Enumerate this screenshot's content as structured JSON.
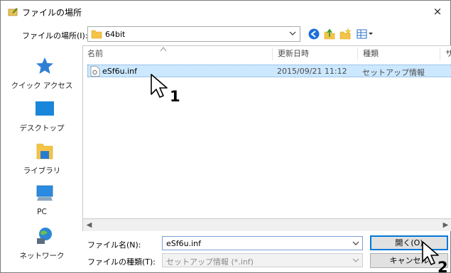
{
  "window": {
    "title": "ファイルの場所",
    "close_glyph": "×"
  },
  "location": {
    "label": "ファイルの場所(I):",
    "value": "64bit"
  },
  "toolbar": {
    "icons": [
      "back-icon",
      "up-folder-icon",
      "new-folder-icon",
      "view-menu-icon"
    ]
  },
  "places": [
    {
      "label": "クイック アクセス",
      "icon": "quick-access-star-icon"
    },
    {
      "label": "デスクトップ",
      "icon": "desktop-icon"
    },
    {
      "label": "ライブラリ",
      "icon": "library-icon"
    },
    {
      "label": "PC",
      "icon": "pc-icon"
    },
    {
      "label": "ネットワーク",
      "icon": "network-icon"
    }
  ],
  "columns": {
    "name": "名前",
    "modified": "更新日時",
    "type": "種類",
    "size": "サ"
  },
  "files": [
    {
      "name": "eSf6u.inf",
      "modified": "2015/09/21 11:12",
      "type": "セットアップ情報",
      "selected": true
    }
  ],
  "filename": {
    "label": "ファイル名(N):",
    "value": "eSf6u.inf"
  },
  "filetype": {
    "label": "ファイルの種類(T):",
    "value": "セットアップ情報 (*.inf)"
  },
  "buttons": {
    "open": "開く(O)",
    "cancel": "キャンセル"
  },
  "annotations": {
    "step1": "1",
    "step2": "2"
  },
  "colors": {
    "selection": "#cce8ff",
    "accent": "#0078d7"
  }
}
